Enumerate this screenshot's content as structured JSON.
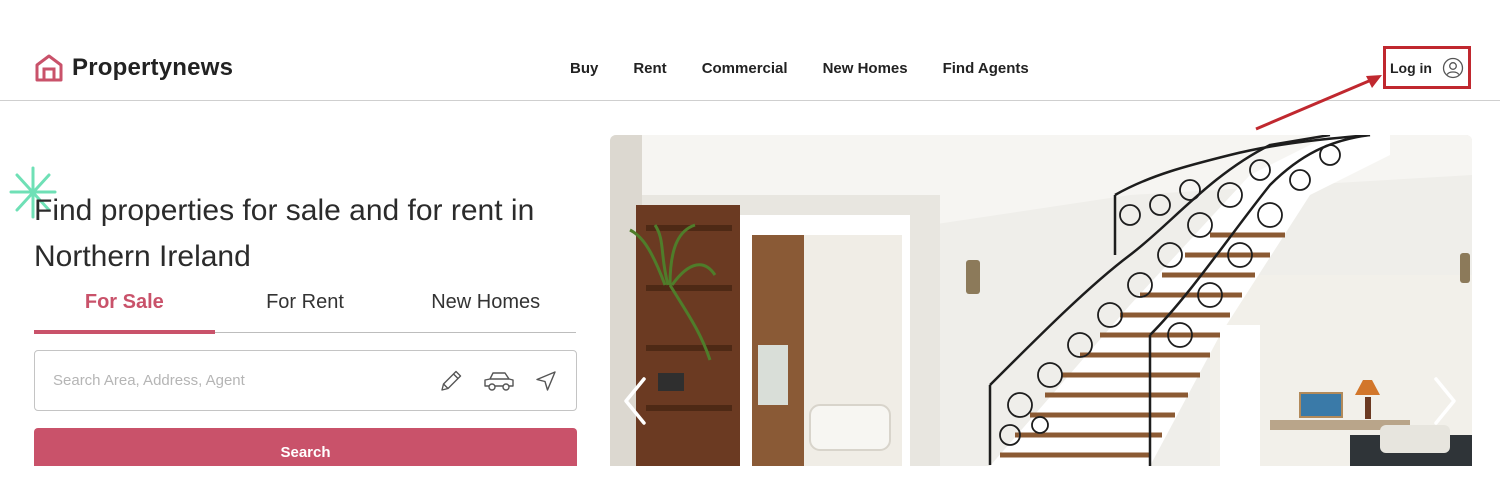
{
  "brand": {
    "name": "Propertynews",
    "accent_color": "#c9526a",
    "logo_icon": "house-icon"
  },
  "nav": {
    "items": [
      {
        "label": "Buy"
      },
      {
        "label": "Rent"
      },
      {
        "label": "Commercial"
      },
      {
        "label": "New Homes"
      },
      {
        "label": "Find Agents"
      }
    ]
  },
  "account": {
    "login_label": "Log in",
    "icon": "user-circle-icon",
    "highlight_color": "#c0282f"
  },
  "hero": {
    "headline_line1": "Find properties for sale and for rent in",
    "headline_line2": "Northern Ireland"
  },
  "search": {
    "tabs": [
      {
        "label": "For Sale",
        "active": true
      },
      {
        "label": "For Rent",
        "active": false
      },
      {
        "label": "New Homes",
        "active": false
      }
    ],
    "placeholder": "Search Area, Address, Agent",
    "value": "",
    "icons": [
      "pencil-icon",
      "car-icon",
      "location-arrow-icon"
    ],
    "button_label": "Search"
  },
  "carousel": {
    "image_subject": "interior staircase",
    "prev_icon": "chevron-left-icon",
    "next_icon": "chevron-right-icon"
  }
}
